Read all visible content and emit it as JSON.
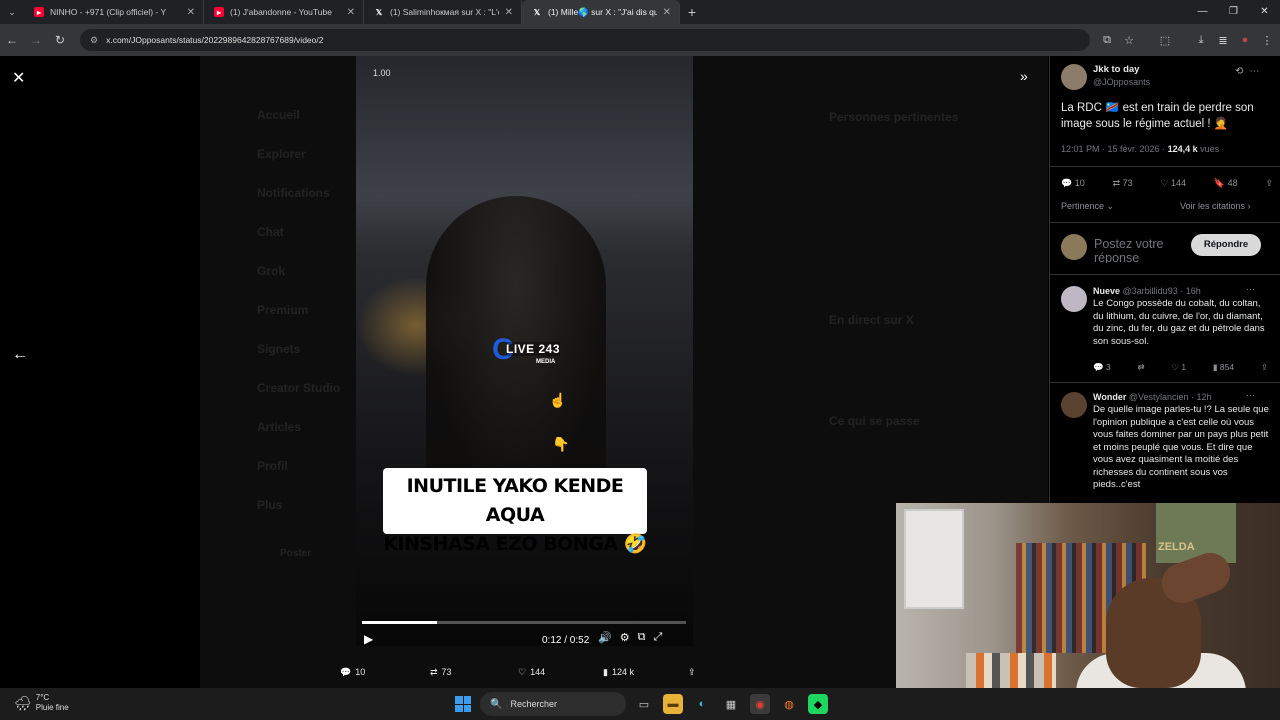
{
  "tabs": [
    {
      "title": "NINHO - +971 (Clip officiel) - Y",
      "color": "#ff0033",
      "active": false
    },
    {
      "title": "(1) J'abandonne - YouTube",
      "color": "#ff0033",
      "active": false
    },
    {
      "title": "(1) Saliminhокмая sur X : \"L'exi",
      "color": "#ffffff",
      "active": false
    },
    {
      "title": "(1) Mille🌎 sur X : \"J'ai dis que",
      "color": "#ffffff",
      "active": true
    }
  ],
  "address": {
    "url": "x.com/JOpposants/status/2022989642828767689/video/2"
  },
  "video": {
    "speed": "1.00",
    "logo_c": "C",
    "logo_live": "LIVE 243",
    "logo_media": "MEDIA",
    "caption_line1": "INUTILE YAKO KENDE AQUA",
    "caption_line2": "KINSHASA EZO BONGA 🤣",
    "time": "0:12 / 0:52",
    "progress": 0.23
  },
  "video_actions": {
    "replies": "10",
    "reposts": "73",
    "likes": "144",
    "views": "124 k"
  },
  "ghost_nav": [
    "Accueil",
    "Explorer",
    "Notifications",
    "Chat",
    "Grok",
    "Premium",
    "Signets",
    "Creator Studio",
    "Articles",
    "Profil",
    "Plus"
  ],
  "ghost_nav_post": "Poster",
  "ghost_right": {
    "relevant": "Personnes pertinentes",
    "live": "En direct sur X",
    "happening": "Ce qui se passe"
  },
  "tweet": {
    "name": "Jkk to day",
    "handle": "@JOpposants",
    "text": "La RDC 🇨🇩 est en train de perdre son image sous le régime actuel ! 🤦",
    "time": "12:01 PM · 15 févr. 2026 · ",
    "views": "124,4 k",
    "views_label": " vues",
    "replies": "10",
    "reposts": "73",
    "likes": "144",
    "bookmarks": "48",
    "sort": "Pertinence",
    "quotes": "Voir les citations"
  },
  "reply_box": {
    "placeholder": "Postez votre réponse",
    "button": "Répondre"
  },
  "comments": [
    {
      "name": "Nueve",
      "handle": "@3arbillidu93 · 16h",
      "text": "Le Congo possède du cobalt, du coltan, du lithium, du cuivre, de l'or, du diamant, du zinc, du fer, du gaz et du pétrole dans son sous-sol.",
      "replies": "3",
      "reposts": "",
      "likes": "1",
      "views": "854"
    },
    {
      "name": "Wonder",
      "handle": "@Vestylancien · 12h",
      "text": "De quelle image parles-tu !? La seule que l'opinion publique a c'est celle où vous vous faites dominer par un pays plus petit et moins peuplé que vous. Et dire que vous avez quasiment la moitié des richesses du continent sous vos pieds..c'est"
    }
  ],
  "webcam": {
    "poster_text": "ZELDA"
  },
  "taskbar": {
    "temp": "7°C",
    "weather": "Pluie fine",
    "search": "Rechercher"
  }
}
